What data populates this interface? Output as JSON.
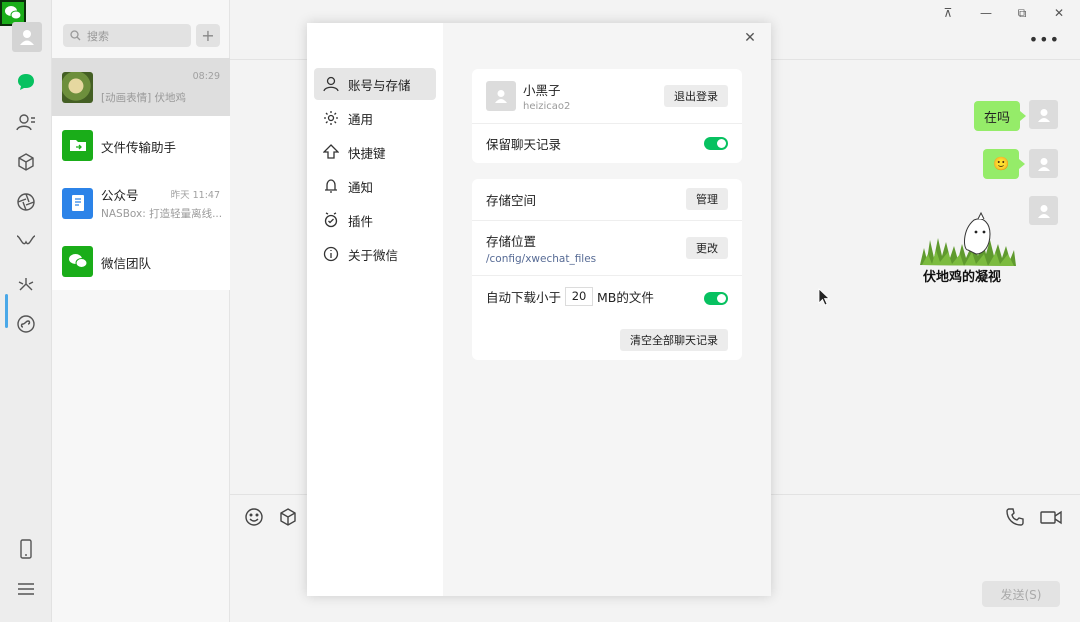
{
  "sidebar": {
    "icons": [
      "chat-icon",
      "contacts-icon",
      "favorites-icon",
      "moments-icon",
      "channels-icon",
      "search-icon",
      "miniprogram-icon",
      "phone-icon",
      "menu-icon"
    ]
  },
  "chat_list": {
    "search_placeholder": "搜索",
    "add_label": "+",
    "items": [
      {
        "name": "",
        "preview": "[动画表情] 伏地鸡",
        "time": "08:29"
      },
      {
        "name": "文件传输助手",
        "preview": "",
        "time": ""
      },
      {
        "name": "公众号",
        "preview": "NASBox: 打造轻量离线...",
        "time": "昨天 11:47"
      },
      {
        "name": "微信团队",
        "preview": "",
        "time": ""
      }
    ]
  },
  "chat": {
    "messages": [
      {
        "type": "text",
        "text": "在吗",
        "side": "right"
      },
      {
        "type": "emoji",
        "text": "🙂",
        "side": "right"
      },
      {
        "type": "sticker",
        "caption": "伏地鸡的凝视",
        "side": "right"
      }
    ],
    "send_label": "发送(S)",
    "more_label": "•••"
  },
  "window_controls": {
    "pin": "⊼",
    "minimize": "—",
    "maximize": "⧉",
    "close": "✕"
  },
  "settings": {
    "close": "✕",
    "nav": [
      {
        "label": "账号与存储",
        "icon": "user-icon",
        "active": true
      },
      {
        "label": "通用",
        "icon": "gear-icon"
      },
      {
        "label": "快捷键",
        "icon": "arrow-up-icon"
      },
      {
        "label": "通知",
        "icon": "bell-icon"
      },
      {
        "label": "插件",
        "icon": "plugin-icon"
      },
      {
        "label": "关于微信",
        "icon": "info-icon"
      }
    ],
    "account": {
      "nickname": "小黑子",
      "wechat_id": "heizicao2",
      "logout_label": "退出登录",
      "keep_history_label": "保留聊天记录",
      "keep_history_on": true
    },
    "storage": {
      "space_label": "存储空间",
      "manage_label": "管理",
      "location_label": "存储位置",
      "location_path": "/config/xwechat_files",
      "change_label": "更改",
      "auto_download_prefix": "自动下载小于",
      "auto_download_value": "20",
      "auto_download_suffix": "MB的文件",
      "auto_download_on": true,
      "clear_label": "清空全部聊天记录"
    }
  },
  "colors": {
    "accent": "#07c160",
    "bubble": "#95ec69",
    "link": "#576b95"
  }
}
